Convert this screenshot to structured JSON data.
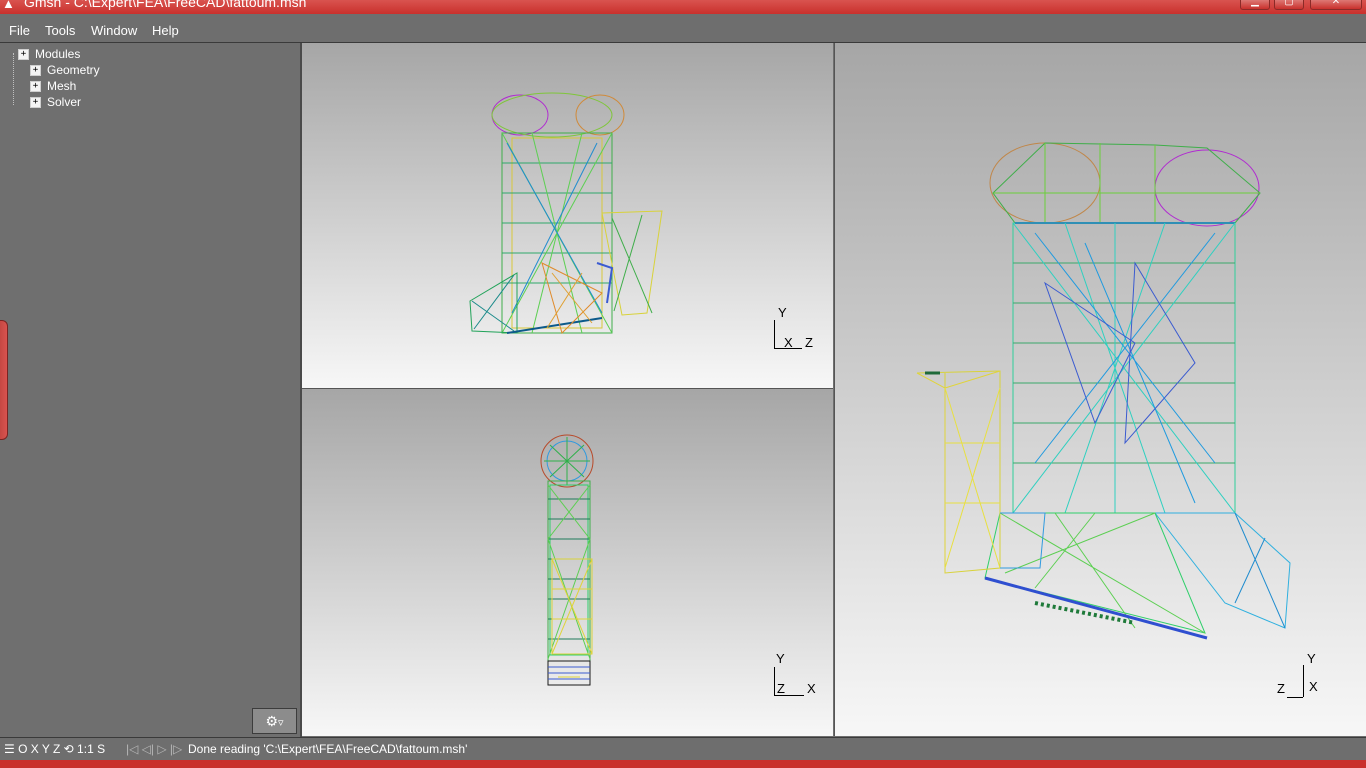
{
  "window": {
    "title": "Gmsh - C:\\Expert\\FEA\\FreeCAD\\fattoum.msh",
    "app_icon": "gmsh-logo-icon",
    "accent": "#c9302c"
  },
  "menu": {
    "file": "File",
    "tools": "Tools",
    "window": "Window",
    "help": "Help"
  },
  "tree": {
    "root": "Modules",
    "items": [
      {
        "label": "Geometry",
        "expander": "+"
      },
      {
        "label": "Mesh",
        "expander": "+"
      },
      {
        "label": "Solver",
        "expander": "+"
      }
    ],
    "root_expander": "+"
  },
  "settings_button": {
    "icon": "gear-icon",
    "glyph": "⚙",
    "arrow": "▿"
  },
  "viewports": {
    "top_left": {
      "axis_up": "Y",
      "axis_a": "X",
      "axis_b": "Z"
    },
    "bottom_left": {
      "axis_up": "Y",
      "axis_a": "Z",
      "axis_b": "X"
    },
    "right": {
      "axis_up": "Y",
      "axis_a": "Z",
      "axis_b": "X"
    }
  },
  "status": {
    "quick_buttons": "☰ O X Y Z ⟲ 1:1 S",
    "anim_buttons": "|◁ ◁| ▷ |▷",
    "message": "Done reading 'C:\\Expert\\FEA\\FreeCAD\\fattoum.msh'"
  }
}
